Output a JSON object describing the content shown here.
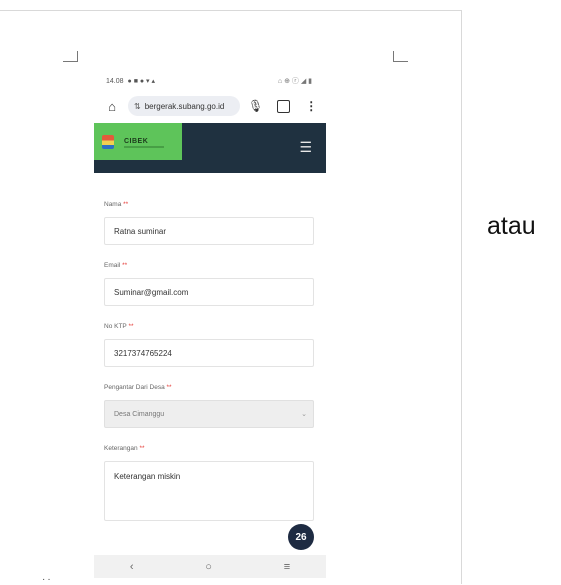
{
  "side_text": "atau",
  "status_bar": {
    "time": "14.08",
    "indicators": "● ■ ● ▾ ▴",
    "right": "⌂ ⊕ ⓡ ◢ ▮"
  },
  "browser": {
    "url": "bergerak.subang.go.id",
    "icons": [
      "home-icon",
      "tune-icon",
      "mic-icon",
      "tab-switch-icon",
      "more-vert-icon"
    ]
  },
  "app": {
    "brand": "CIBEK",
    "menu_icon": "☰"
  },
  "form": {
    "required_mark": "**",
    "fields": [
      {
        "label": "Nama",
        "value": "Ratna suminar"
      },
      {
        "label": "Email",
        "value": "Suminar@gmail.com"
      },
      {
        "label": "No KTP",
        "value": "3217374765224"
      },
      {
        "label": "Pengantar Dari Desa",
        "value": "Desa Cimanggu"
      },
      {
        "label": "Keterangan",
        "value": "Keterangan miskin"
      }
    ]
  },
  "fab": {
    "label": "26"
  },
  "nav": {
    "back": "‹",
    "home": "○",
    "recents": "≡"
  }
}
